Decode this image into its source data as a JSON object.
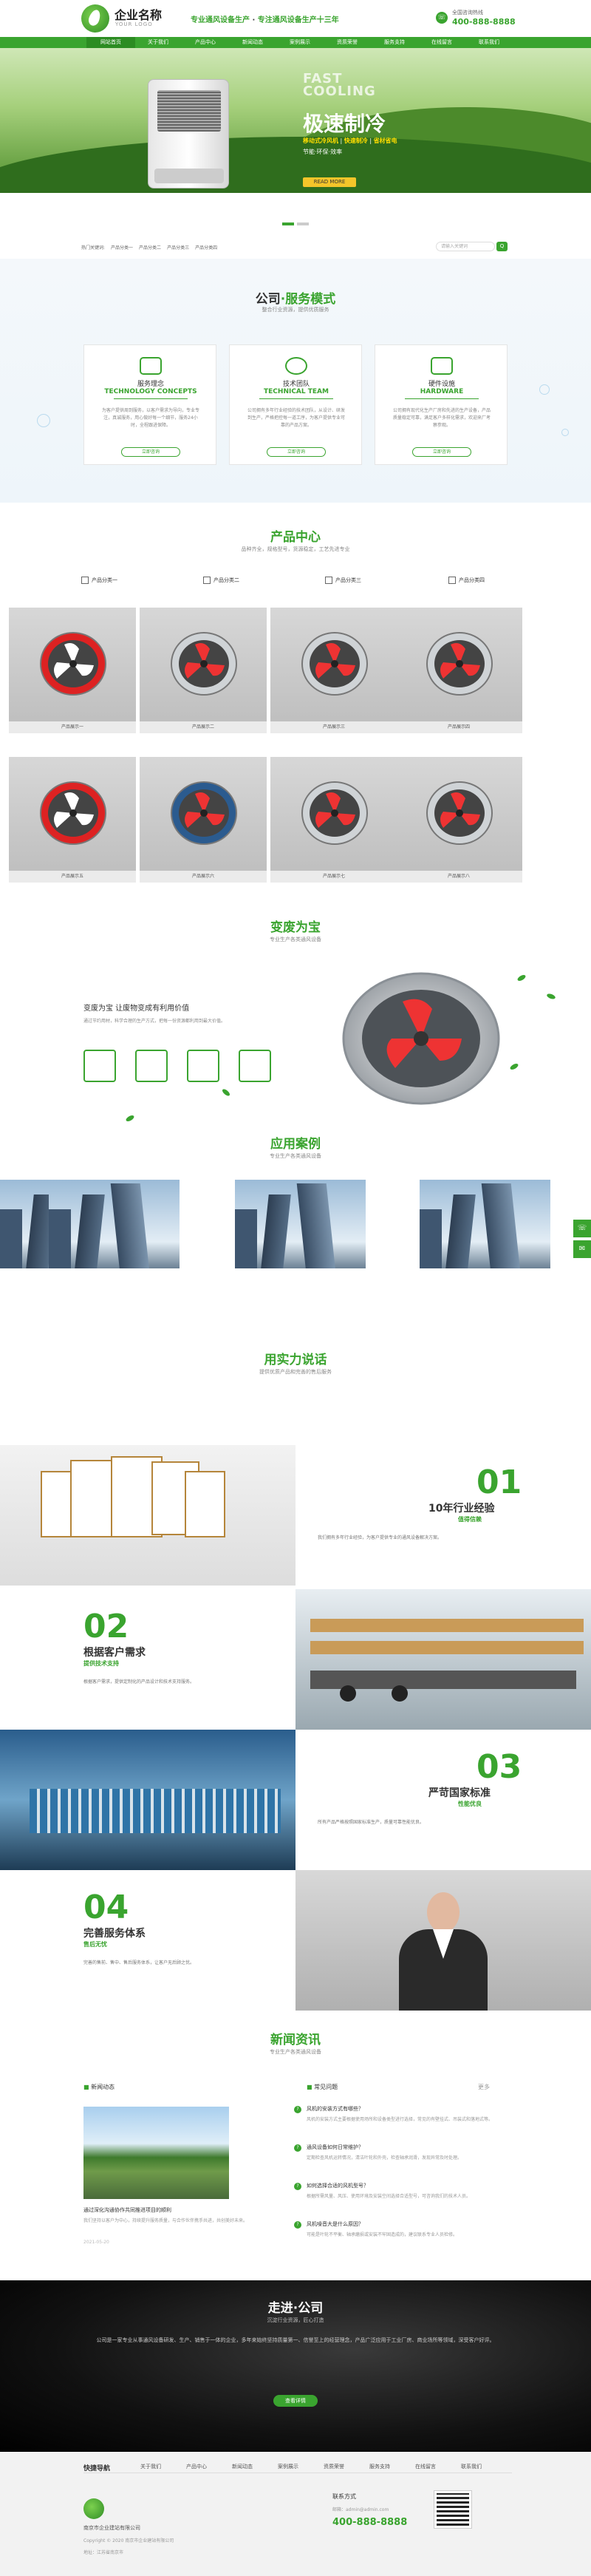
{
  "header": {
    "brand": "企业名称",
    "brand_sub": "YOUR LOGO",
    "slogan_a": "专业通风设备生产",
    "slogan_sep": "·",
    "slogan_b": "专注通风设备生产十三年",
    "hotline_label": "全国咨询热线",
    "hotline": "400-888-8888"
  },
  "nav": [
    "网站首页",
    "关于我们",
    "产品中心",
    "新闻动态",
    "案例展示",
    "资质荣誉",
    "服务支持",
    "在线留言",
    "联系我们"
  ],
  "banner": {
    "en1": "FAST",
    "en2": "COOLING",
    "cn": "极速制冷",
    "line1_a": "移动式冷风机",
    "line1_b": "快速制冷",
    "line1_c": "省材省电",
    "line2": "节能·环保·效率",
    "button": "READ MORE"
  },
  "breadcrumb": [
    "热门关键词:",
    "产品分类一",
    "产品分类二",
    "产品分类三",
    "产品分类四"
  ],
  "search": {
    "placeholder": "请输入关键词",
    "button": "Q"
  },
  "service": {
    "title_a": "公司",
    "title_b": "服务模式",
    "sub": "整合行业资源，提供优质服务",
    "cards": [
      {
        "cn": "服务理念",
        "en": "TECHNOLOGY CONCEPTS",
        "text": "为客户提供周到服务，以客户需求为导向，专业专注，真诚服务，用心做好每一个细节，服务24小时，全程跟进保障。",
        "btn": "立即咨询"
      },
      {
        "cn": "技术团队",
        "en": "TECHNICAL TEAM",
        "text": "公司拥有多年行业经验的技术团队，从设计、研发到生产，严格把控每一道工序，为客户提供专业可靠的产品方案。",
        "btn": "立即咨询"
      },
      {
        "cn": "硬件设施",
        "en": "HARDWARE",
        "text": "公司拥有现代化生产厂房和先进的生产设备，产品质量稳定可靠，满足客户多样化需求，欢迎来厂考察参观。",
        "btn": "立即咨询"
      }
    ]
  },
  "products": {
    "title": "产品中心",
    "sub": "品种齐全，规格型号，货源稳定，工艺先进专业",
    "tabs": [
      "产品分类一",
      "产品分类二",
      "产品分类三",
      "产品分类四"
    ],
    "items": [
      "产品展示一",
      "产品展示二",
      "产品展示三",
      "产品展示四",
      "产品展示五",
      "产品展示六",
      "产品展示七",
      "产品展示八"
    ]
  },
  "recycle": {
    "title": "变废为宝",
    "sub": "专业生产各类通风设备",
    "headline": "变废为宝 让废物变成有利用价值",
    "text": "通过节约用材，科学合理的生产方式，把每一份资源都利用到最大价值。"
  },
  "cases": {
    "title": "应用案例",
    "sub": "专业生产各类通风设备"
  },
  "strength": {
    "title": "用实力说话",
    "sub": "提供优质产品和完善的售后服务",
    "blocks": [
      {
        "num": "01",
        "h": "10年行业经验",
        "s": "值得信赖",
        "p": "我们拥有多年行业经验，为客户提供专业的通风设备解决方案。"
      },
      {
        "num": "02",
        "h": "根据客户需求",
        "s": "提供技术支持",
        "p": "根据客户需求，提供定制化的产品设计和技术支持服务。"
      },
      {
        "num": "03",
        "h": "严苛国家标准",
        "s": "性能优良",
        "p": "所有产品严格按照国家标准生产，质量可靠性能优良。"
      },
      {
        "num": "04",
        "h": "完善服务体系",
        "s": "售后无忧",
        "p": "完善的售前、售中、售后服务体系，让客户无后顾之忧。"
      }
    ]
  },
  "news": {
    "title": "新闻资讯",
    "sub": "专业生产各类通风设备",
    "left_h": "新闻动态",
    "right_h": "常见问题",
    "more": "更多",
    "main_title": "通过深化沟通协作共同推进项目的顺利",
    "main_text": "我们坚持以客户为中心，持续提升服务质量，与合作伙伴携手共进，共创美好未来。",
    "main_date": "2021-05-20",
    "faq": [
      {
        "t": "风机的安装方式有哪些？",
        "d": "风机的安装方式主要根据使用场所和设备类型进行选择，常见的有壁挂式、吊装式和落地式等。"
      },
      {
        "t": "通风设备如何日常维护？",
        "d": "定期检查风机运转情况，清洁叶轮和外壳，检查轴承润滑，发现异常及时处理。"
      },
      {
        "t": "如何选择合适的风机型号？",
        "d": "根据所需风量、风压、使用环境及安装空间选择合适型号，可咨询我们的技术人员。"
      },
      {
        "t": "风机噪音大是什么原因？",
        "d": "可能是叶轮不平衡、轴承磨损或安装不牢固造成的，建议联系专业人员检修。"
      }
    ]
  },
  "about": {
    "title": "走进·公司",
    "sub": "沉淀行业资源，匠心打造",
    "text": "公司是一家专业从事通风设备研发、生产、销售于一体的企业，多年来始终坚持质量第一、信誉至上的经营理念，产品广泛应用于工业厂房、商业场所等领域，深受客户好评。",
    "btn": "查看详情"
  },
  "footer": {
    "quick": "快捷导航",
    "nav": [
      "关于我们",
      "产品中心",
      "新闻动态",
      "案例展示",
      "资质荣誉",
      "服务支持",
      "在线留言",
      "联系我们"
    ],
    "company": "南京市企业建站有限公司",
    "addr": "地址：江苏省南京市",
    "phone_l": "联系方式",
    "email": "邮箱：admin@admin.com",
    "hotline": "400-888-8888",
    "copy": "Copyright © 2020 南京市企业建站有限公司"
  },
  "side": [
    "☏",
    "✉"
  ]
}
